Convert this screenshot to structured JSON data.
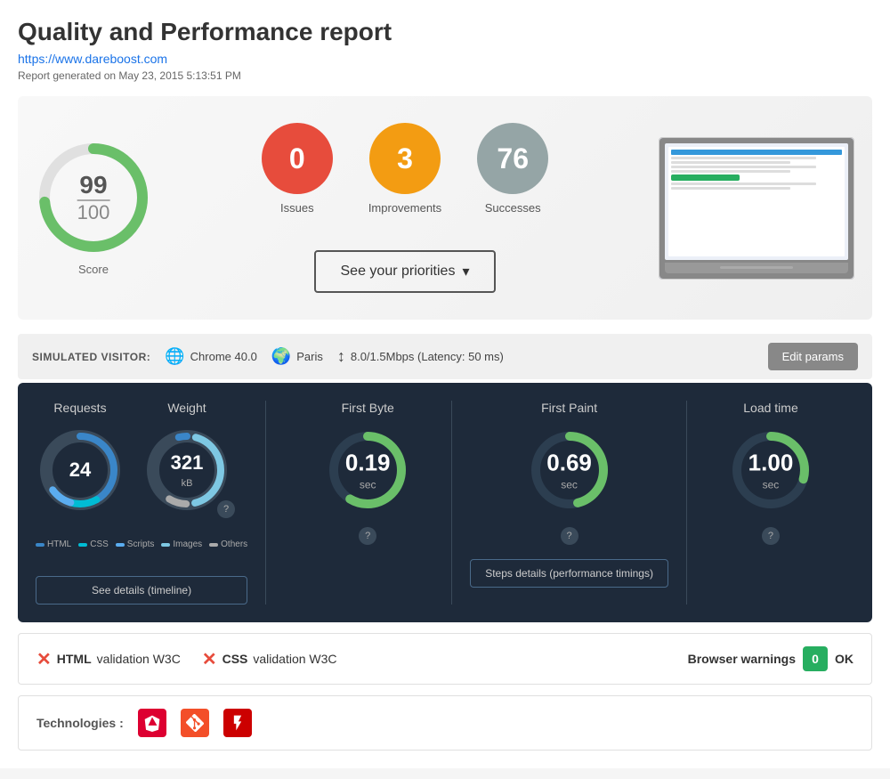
{
  "header": {
    "title": "Quality and Performance report",
    "url": "https://www.dareboost.com",
    "date": "Report generated on May 23, 2015 5:13:51 PM"
  },
  "summary": {
    "score": "99",
    "score_denom": "100",
    "score_label": "Score",
    "issues_count": "0",
    "issues_label": "Issues",
    "improvements_count": "3",
    "improvements_label": "Improvements",
    "successes_count": "76",
    "successes_label": "Successes",
    "priorities_btn": "See your priorities",
    "chevron": "▾"
  },
  "visitor": {
    "label": "SIMULATED VISITOR:",
    "browser": "Chrome 40.0",
    "location": "Paris",
    "bandwidth": "8.0/1.5Mbps (Latency: 50 ms)",
    "edit_btn": "Edit params"
  },
  "stats": {
    "requests_label": "Requests",
    "requests_count": "24",
    "weight_label": "Weight",
    "weight_count": "321",
    "weight_unit": "kB",
    "legend": [
      {
        "label": "HTML",
        "color": "#3a86c8"
      },
      {
        "label": "CSS",
        "color": "#00bcd4"
      },
      {
        "label": "Scripts",
        "color": "#5badf0"
      },
      {
        "label": "Images",
        "color": "#7ec8e3"
      },
      {
        "label": "Others",
        "color": "#aaa"
      }
    ],
    "timeline_btn": "See details (timeline)",
    "first_byte_label": "First Byte",
    "first_byte_value": "0.19",
    "first_byte_unit": "sec",
    "first_paint_label": "First Paint",
    "first_paint_value": "0.69",
    "first_paint_unit": "sec",
    "load_time_label": "Load time",
    "load_time_value": "1.00",
    "load_time_unit": "sec",
    "timings_btn": "Steps details (performance timings)"
  },
  "validation": {
    "html_label": "HTML",
    "html_suffix": "validation W3C",
    "css_label": "CSS",
    "css_suffix": "validation W3C",
    "browser_warnings_label": "Browser warnings",
    "browser_warnings_count": "0",
    "browser_warnings_ok": "OK"
  },
  "technologies": {
    "label": "Technologies :",
    "items": [
      "Angular",
      "Git",
      "Flash"
    ]
  }
}
